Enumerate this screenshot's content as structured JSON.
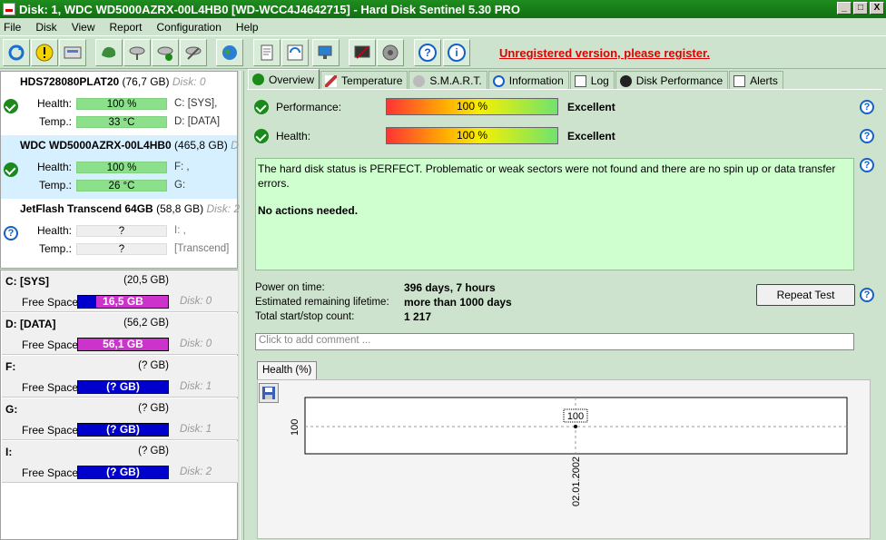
{
  "window": {
    "title": "Disk: 1, WDC WD5000AZRX-00L4HB0 [WD-WCC4J4642715]  -  Hard Disk Sentinel 5.30 PRO",
    "min": "_",
    "max": "□",
    "close": "X"
  },
  "menu": [
    "File",
    "Disk",
    "View",
    "Report",
    "Configuration",
    "Help"
  ],
  "toolbar": {
    "icons": [
      "refresh-icon",
      "warning-icon",
      "disk-icon",
      "disk-green-icon",
      "disk-settings-icon",
      "disk-check-icon",
      "disk-tools-icon",
      "globe-icon",
      "report-icon",
      "sync-icon",
      "network-icon",
      "console-icon",
      "speaker-icon",
      "help-icon",
      "info-icon"
    ],
    "unregistered": "Unregistered version, please register."
  },
  "disks": [
    {
      "name": "HDS728080PLAT20",
      "size": "(76,7 GB)",
      "disk": "Disk: 0",
      "health": "100 %",
      "temp": "33 °C",
      "drive1": "C: [SYS],",
      "drive2": "D: [DATA]",
      "status": "ok",
      "health_pct": 100
    },
    {
      "name": "WDC WD5000AZRX-00L4HB0",
      "size": "(465,8 GB)",
      "disk": "D",
      "health": "100 %",
      "temp": "26 °C",
      "drive1": "F: ,",
      "drive2": "G:",
      "status": "ok",
      "health_pct": 100
    },
    {
      "name": "JetFlash Transcend 64GB",
      "size": "(58,8 GB)",
      "disk": "Disk: 2",
      "health": "?",
      "temp": "?",
      "drive1": "I: ,",
      "drive2": "[Transcend]",
      "status": "unknown",
      "health_pct": 0
    }
  ],
  "labels": {
    "health": "Health:",
    "temp": "Temp.:",
    "free_space": "Free Space"
  },
  "volumes": [
    {
      "name": "C: [SYS]",
      "size": "(20,5 GB)",
      "free": "16,5 GB",
      "disk": "Disk: 0",
      "color": "#cc33cc"
    },
    {
      "name": "D: [DATA]",
      "size": "(56,2 GB)",
      "free": "56,1 GB",
      "disk": "Disk: 0",
      "color": "#cc33cc"
    },
    {
      "name": "F:",
      "size": "(? GB)",
      "free": "(? GB)",
      "disk": "Disk: 1",
      "color": "#0000cc"
    },
    {
      "name": "G:",
      "size": "(? GB)",
      "free": "(? GB)",
      "disk": "Disk: 1",
      "color": "#0000cc"
    },
    {
      "name": "I:",
      "size": "(? GB)",
      "free": "(? GB)",
      "disk": "Disk: 2",
      "color": "#0000cc"
    }
  ],
  "tabs": [
    "Overview",
    "Temperature",
    "S.M.A.R.T.",
    "Information",
    "Log",
    "Disk Performance",
    "Alerts"
  ],
  "overview": {
    "performance_label": "Performance:",
    "performance_value": "100 %",
    "performance_rating": "Excellent",
    "health_label": "Health:",
    "health_value": "100 %",
    "health_rating": "Excellent",
    "status_text": "The hard disk status is PERFECT. Problematic or weak sectors were not found and there are no spin up or data transfer errors.",
    "actions": "No actions needed.",
    "power_on_label": "Power on time:",
    "power_on_value": "396 days, 7 hours",
    "lifetime_label": "Estimated remaining lifetime:",
    "lifetime_value": "more than 1000 days",
    "startstop_label": "Total start/stop count:",
    "startstop_value": "1 217",
    "repeat_test": "Repeat Test",
    "comment_placeholder": "Click to add comment ..."
  },
  "graph": {
    "tab": "Health (%)"
  },
  "chart_data": {
    "type": "line",
    "x": [
      "02.01.2002"
    ],
    "values": [
      100
    ],
    "y_tick": "100",
    "point_label": "100"
  }
}
